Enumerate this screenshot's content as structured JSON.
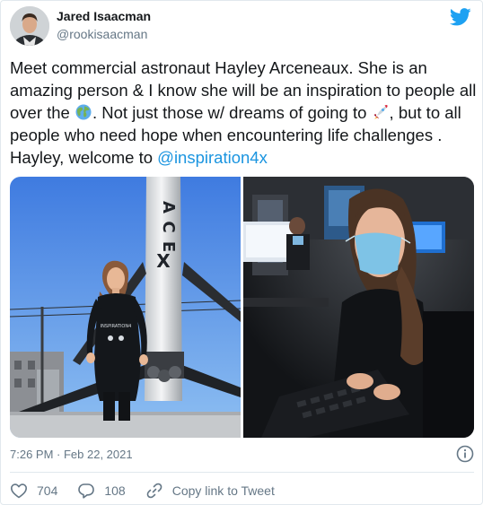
{
  "author": {
    "name": "Jared Isaacman",
    "handle": "@rookisaacman"
  },
  "tweet": {
    "text_before_globe": "Meet commercial astronaut Hayley Arceneaux. She is an amazing person & I know she will be an inspiration to people all over the ",
    "globe_emoji": "🌍",
    "text_before_rocket": ". Not just those w/ dreams of going to ",
    "rocket_emoji": "🚀",
    "text_before_mention": ", but to all people who need hope when encountering life challenges . Hayley, welcome to ",
    "mention": "@inspiration4x"
  },
  "media": {
    "left_photo": {
      "rocket_text": "SPACEX",
      "shirt_text": "INSPIRATION4"
    },
    "right_photo": {}
  },
  "meta": {
    "timestamp": "7:26 PM · Feb 22, 2021"
  },
  "actions": {
    "likes": "704",
    "replies": "108",
    "copy_link": "Copy link to Tweet"
  },
  "colors": {
    "link": "#1b95e0",
    "secondary_text": "#657786",
    "twitter_blue": "#1da1f2",
    "divider": "#e1e8ed"
  },
  "icons": {
    "brand": "twitter-bird-icon",
    "info": "info-circle-icon",
    "like": "heart-icon",
    "reply": "speech-bubble-icon",
    "copy": "link-icon"
  }
}
